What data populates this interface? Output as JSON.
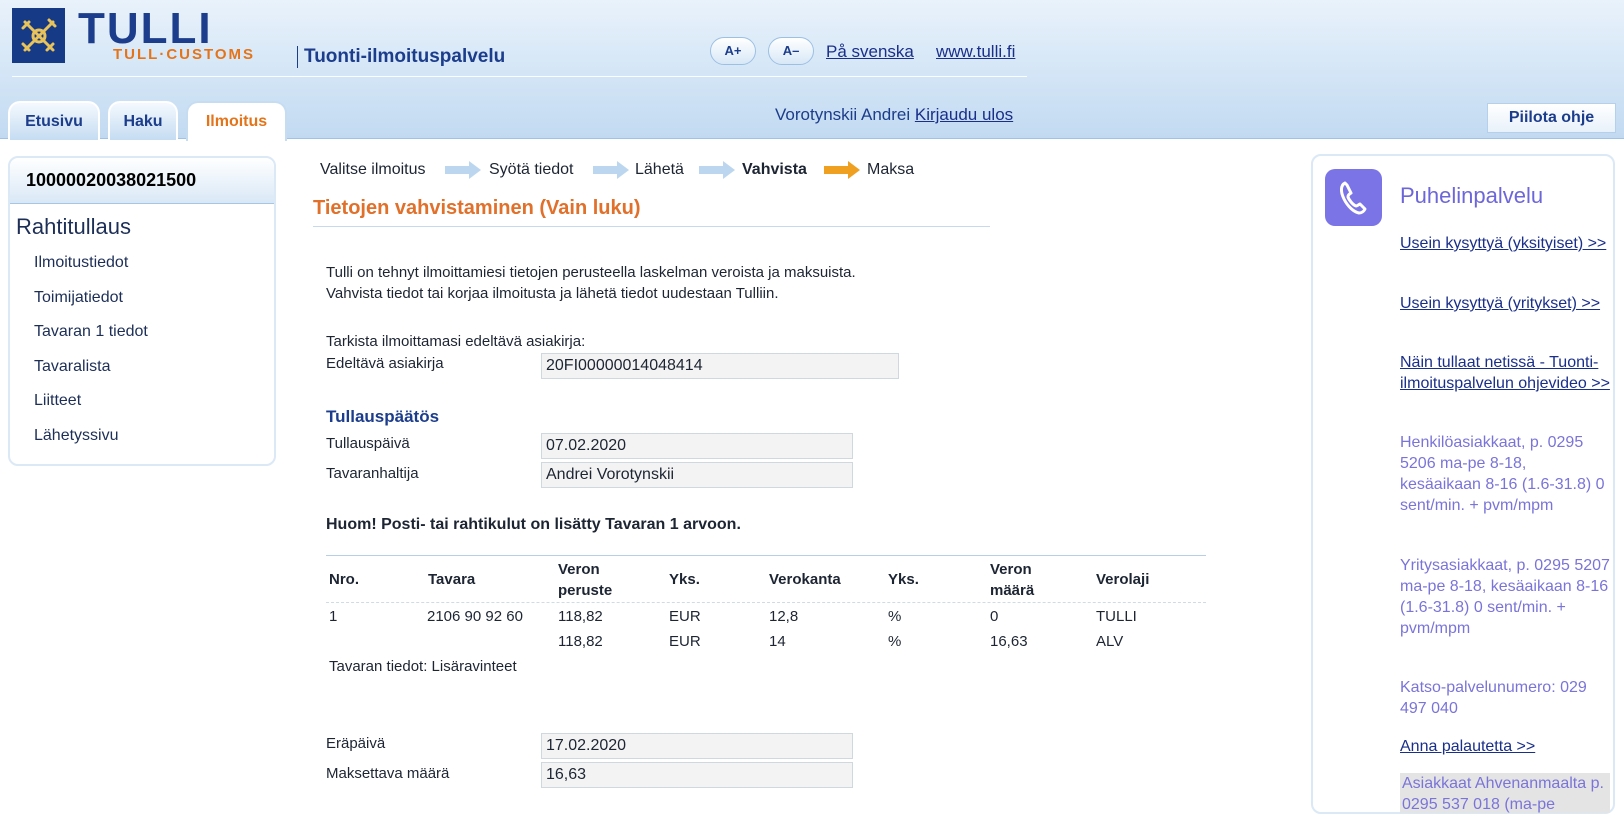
{
  "header": {
    "logo_word": "TULLI",
    "logo_sub": "TULL·CUSTOMS",
    "service_name": "Tuonti-ilmoituspalvelu",
    "font_larger": "A+",
    "font_smaller": "A–",
    "lang_link": "På svenska",
    "site_link": "www.tulli.fi",
    "user_name": "Vorotynskii Andrei",
    "logout_link": "Kirjaudu ulos",
    "hide_help": "Piilota ohje"
  },
  "tabs": [
    {
      "label": "Etusivu"
    },
    {
      "label": "Haku"
    },
    {
      "label": "Ilmoitus"
    }
  ],
  "sidebar": {
    "reference": "10000020038021500",
    "title": "Rahtitullaus",
    "items": [
      {
        "label": "Ilmoitustiedot"
      },
      {
        "label": "Toimijatiedot"
      },
      {
        "label": "Tavaran 1 tiedot"
      },
      {
        "label": "Tavaralista"
      },
      {
        "label": "Liitteet"
      },
      {
        "label": "Lähetyssivu"
      }
    ]
  },
  "steps": [
    {
      "label": "Valitse ilmoitus"
    },
    {
      "label": "Syötä tiedot"
    },
    {
      "label": "Lähetä"
    },
    {
      "label": "Vahvista"
    },
    {
      "label": "Maksa"
    }
  ],
  "main": {
    "title": "Tietojen vahvistaminen  (Vain luku)",
    "intro_line1": "Tulli on tehnyt ilmoittamiesi tietojen perusteella laskelman veroista ja maksuista.",
    "intro_line2": "Vahvista tiedot tai korjaa ilmoitusta ja lähetä tiedot uudestaan Tulliin.",
    "check_text": "Tarkista ilmoittamasi edeltävä asiakirja:",
    "prev_doc_label": "Edeltävä asiakirja",
    "prev_doc_value": "20FI00000014048414",
    "decision_heading": "Tullauspäätös",
    "customs_date_label": "Tullauspäivä",
    "customs_date_value": "07.02.2020",
    "holder_label": "Tavaranhaltija",
    "holder_value": "Andrei Vorotynskii",
    "note": "Huom! Posti- tai rahtikulut on lisätty Tavaran 1 arvoon.",
    "goods_info": "Tavaran tiedot: Lisäravinteet",
    "due_label": "Eräpäivä",
    "due_value": "17.02.2020",
    "amount_label": "Maksettava määrä",
    "amount_value": "16,63"
  },
  "table": {
    "headers": {
      "nro": "Nro.",
      "tavara": "Tavara",
      "peruste_1": "Veron",
      "peruste_2": "peruste",
      "yks1": "Yks.",
      "verokanta": "Verokanta",
      "yks2": "Yks.",
      "maara_1": "Veron",
      "maara_2": "määrä",
      "verolaji": "Verolaji"
    },
    "rows": [
      {
        "nro": "1",
        "tavara": "2106 90 92 60",
        "peruste": "118,82",
        "yks1": "EUR",
        "verokanta": "12,8",
        "yks2": "%",
        "maara": "0",
        "verolaji": "TULLI"
      },
      {
        "nro": "",
        "tavara": "",
        "peruste": "118,82",
        "yks1": "EUR",
        "verokanta": "14",
        "yks2": "%",
        "maara": "16,63",
        "verolaji": "ALV"
      }
    ]
  },
  "right_panel": {
    "title": "Puhelinpalvelu",
    "link1": "Usein kysyttyä (yksityiset) >>",
    "link2": "Usein kysyttyä (yritykset) >>",
    "link3": "Näin tullaat netissä - Tuonti-ilmoituspalvelun ohjevideo >>",
    "private_block": "Henkilöasiakkaat, p. 0295 5206 ma-pe 8-18, kesäaikaan 8-16 (1.6-31.8) 0 sent/min. + pvm/mpm",
    "business_block": "Yritysasiakkaat, p. 0295 5207 ma-pe 8-18, kesäaikaan 8-16 (1.6-31.8) 0 sent/min. + pvm/mpm",
    "katso": "Katso-palvelunumero: 029 497 040",
    "feedback_link": "Anna palautetta >>",
    "aland": "Asiakkaat Ahvenanmaalta p. 0295 537 018 (ma-pe"
  },
  "colors": {
    "brand_blue": "#1c3d8c",
    "brand_orange": "#e4741a",
    "active_arrow": "#f0a020",
    "inactive_arrow": "#bcd6ef",
    "panel_violet": "#7b74e6"
  }
}
